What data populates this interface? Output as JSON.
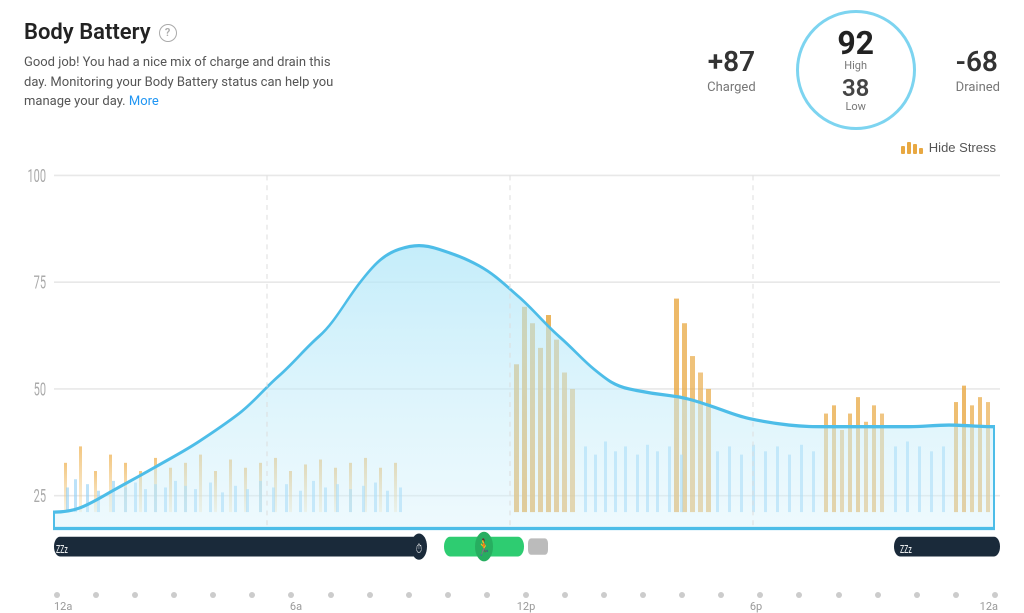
{
  "header": {
    "title": "Body Battery",
    "help_icon": "?",
    "description": "Good job! You had a nice mix of charge and drain this day. Monitoring your Body Battery status can help you manage your day.",
    "more_link": "More"
  },
  "stats": {
    "charged_value": "+87",
    "charged_label": "Charged",
    "high_value": "92",
    "high_label": "High",
    "low_value": "38",
    "low_label": "Low",
    "drained_value": "-68",
    "drained_label": "Drained"
  },
  "toolbar": {
    "hide_stress_label": "Hide Stress"
  },
  "chart": {
    "y_labels": [
      "100",
      "75",
      "50",
      "25"
    ],
    "time_labels": [
      "12a",
      "6a",
      "12p",
      "6p",
      "12a"
    ],
    "accent_color": "#7dd4f0",
    "stress_color": "#e8a842"
  }
}
